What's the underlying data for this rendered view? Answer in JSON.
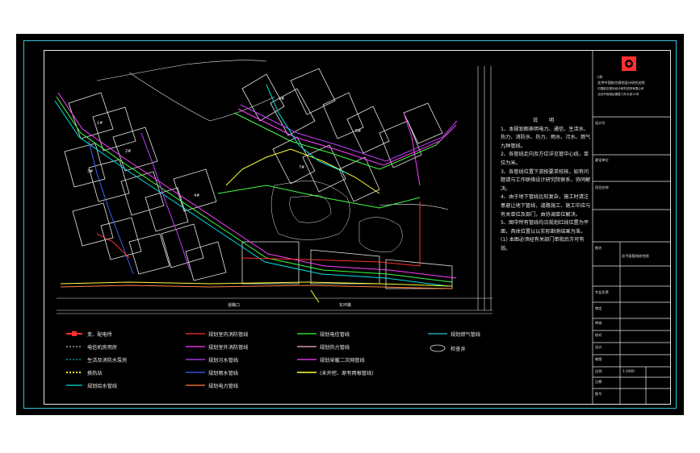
{
  "drawing": {
    "notes_title": "说 明",
    "notes": [
      "1、本规划图表明电力、通信、生活水、热力、消防水、热力、雨水、污水、燃气九种管线。",
      "2、各管线走向及方位详见管中心线，单位为米。",
      "3、各管线位置下游按要求校核，如有问题请与工作联络设计研究院联系，协同解决。",
      "4、由于地下管线比较复杂，施工时请注意避让地下管线，道路施工、施工中应与有关单位及部门，由协调单位解决。",
      "5、图中所有管线均沿规划红线位置为平面，具体位置以以实际勘测结果为准。",
      "(1) 本图必须经有关部门审批后方可有效。"
    ],
    "road_labels": [
      "道路口",
      "东环路"
    ],
    "building_labels": [
      "1#",
      "2#",
      "3#",
      "4#",
      "5#",
      "6#",
      "7#"
    ]
  },
  "title_block": {
    "logo_text": "LBI",
    "company": "北京中国航空规划设计研究总院",
    "rows": [
      "中国航空规划设计研究总院有限公司",
      "北京市西城区德胜门外大街12号",
      "设计号",
      "建设单位",
      "项目名称",
      "图名",
      "总平面管线综合图",
      "专业负责",
      "审定",
      "审核",
      "校对",
      "设计",
      "制图",
      "比例",
      "日期",
      "图号"
    ],
    "scale": "1:1000"
  },
  "legend": [
    {
      "label": "变、配电所",
      "color": "#ff3030",
      "style": "block"
    },
    {
      "label": "电信机房用房",
      "color": "#e8e8e8",
      "style": "dash"
    },
    {
      "label": "生活及消防水泵房",
      "color": "#00e0e0",
      "style": "dash"
    },
    {
      "label": "换热站",
      "color": "#ffff30",
      "style": "dash"
    },
    {
      "label": "规划给水管线",
      "color": "#00e0e0",
      "style": "solid"
    },
    {
      "label": "规划室内消防管线",
      "color": "#ff3030",
      "style": "solid"
    },
    {
      "label": "规划室外消防管线",
      "color": "#ff40ff",
      "style": "solid"
    },
    {
      "label": "规划污水管线",
      "color": "#c040ff",
      "style": "solid"
    },
    {
      "label": "规划雨水管线",
      "color": "#4060ff",
      "style": "solid"
    },
    {
      "label": "规划电力管线",
      "color": "#ff8040",
      "style": "solid"
    },
    {
      "label": "规划电信管线",
      "color": "#40ff40",
      "style": "solid"
    },
    {
      "label": "规划热力管线",
      "color": "#ffb0d0",
      "style": "solid"
    },
    {
      "label": "规划采暖二次网管线",
      "color": "#ff40ff",
      "style": "solid"
    },
    {
      "label": "(未开挖、原有两根管线)",
      "color": "#ffff30",
      "style": "solid"
    },
    {
      "label": "规划燃气管线",
      "color": "#2ec4d6",
      "style": "solid"
    },
    {
      "label": "检查井",
      "color": "#e8e8e8",
      "style": "ellipse"
    }
  ],
  "colors": {
    "frame": "#2ec4d6",
    "background": "#000000",
    "lines": "#e8e8e8"
  }
}
